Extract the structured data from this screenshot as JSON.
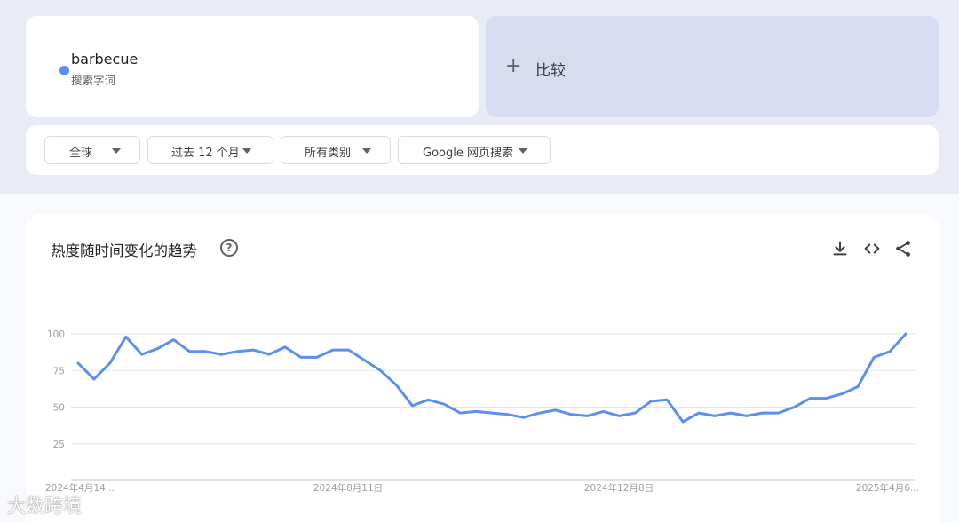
{
  "search_term": {
    "name": "barbecue",
    "subtitle": "搜索字词",
    "color": "#5b8ff0"
  },
  "compare": {
    "label": "比较"
  },
  "filters": [
    {
      "label": "全球"
    },
    {
      "label": "过去 12 个月"
    },
    {
      "label": "所有类别"
    },
    {
      "label": "Google 网页搜索"
    }
  ],
  "chart_section": {
    "title": "热度随时间变化的趋势",
    "help_glyph": "?"
  },
  "chart_data": {
    "type": "line",
    "title": "",
    "xlabel": "",
    "ylabel": "",
    "ylim": [
      0,
      100
    ],
    "y_ticks": [
      "100",
      "75",
      "50",
      "25"
    ],
    "x_tick_labels": [
      "2024年4月14...",
      "2024年8月11日",
      "2024年12月8日",
      "2025年4月6..."
    ],
    "grid": true,
    "series": [
      {
        "name": "barbecue",
        "color": "#5b8ff0",
        "values": [
          80,
          69,
          80,
          98,
          86,
          90,
          96,
          88,
          88,
          86,
          88,
          89,
          86,
          91,
          84,
          84,
          89,
          89,
          82,
          75,
          65,
          51,
          55,
          52,
          46,
          47,
          46,
          45,
          43,
          46,
          48,
          45,
          44,
          47,
          44,
          46,
          54,
          55,
          40,
          46,
          44,
          46,
          44,
          46,
          46,
          50,
          56,
          56,
          59,
          64,
          84,
          88,
          100
        ]
      }
    ]
  },
  "watermark": "大数跨境"
}
